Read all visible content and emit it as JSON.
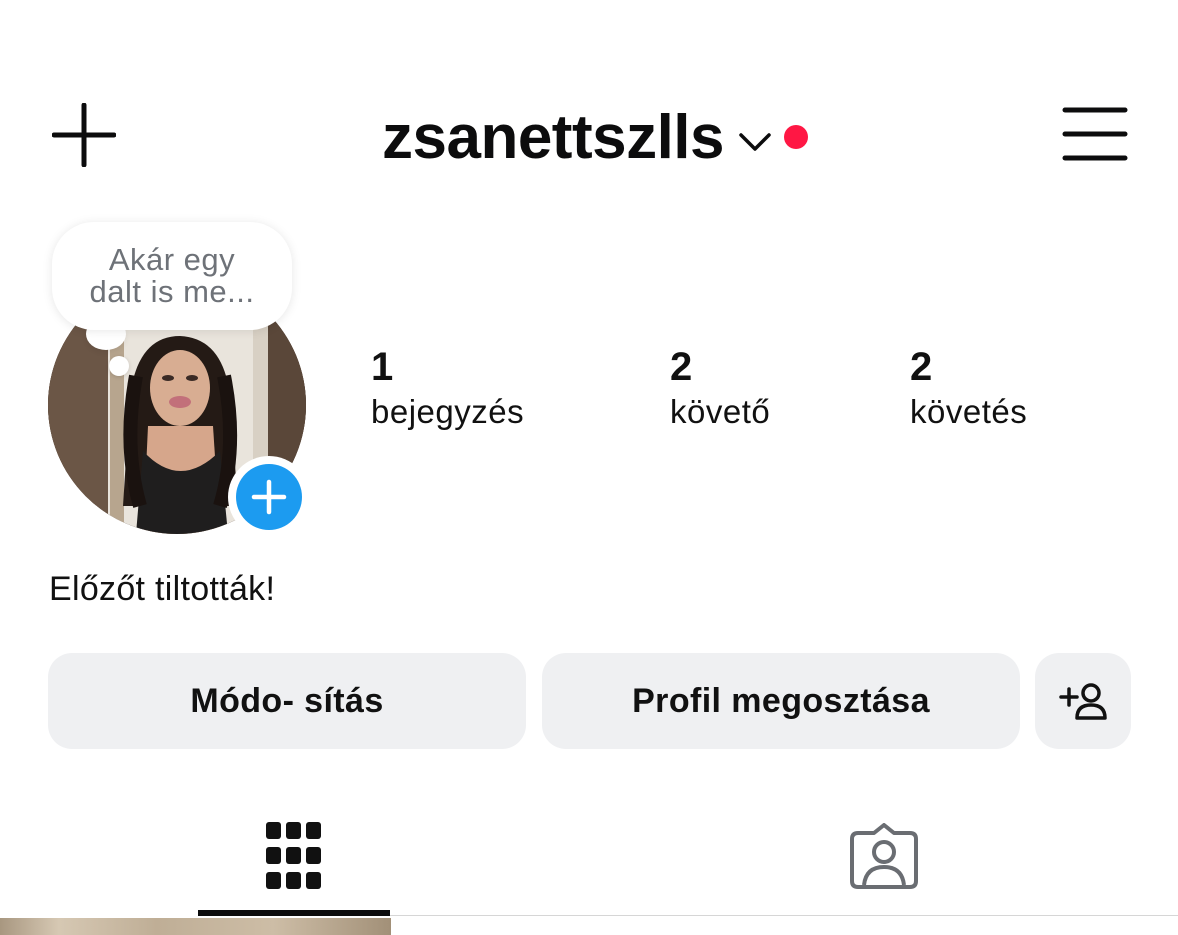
{
  "header": {
    "username": "zsanettszlls",
    "create_icon": "plus-icon",
    "menu_icon": "hamburger-menu-icon",
    "switch_account_icon": "chevron-down-icon",
    "notification_dot_color": "#ff1744"
  },
  "note": {
    "line1": "Akár egy",
    "line2": "dalt is me..."
  },
  "avatar": {
    "add_story_icon": "plus-circle-icon",
    "add_story_color": "#1c9bf0"
  },
  "stats": [
    {
      "value": "1",
      "label": "bejegyzés"
    },
    {
      "value": "2",
      "label": "követő"
    },
    {
      "value": "2",
      "label": "követés"
    }
  ],
  "bio": "Előzőt tiltották!",
  "actions": {
    "edit_label": "Módo- sítás",
    "share_label": "Profil megosztása",
    "discover_icon": "add-person-icon"
  },
  "tabs": [
    {
      "icon": "grid-icon",
      "active": true
    },
    {
      "icon": "tagged-person-icon",
      "active": false
    }
  ]
}
